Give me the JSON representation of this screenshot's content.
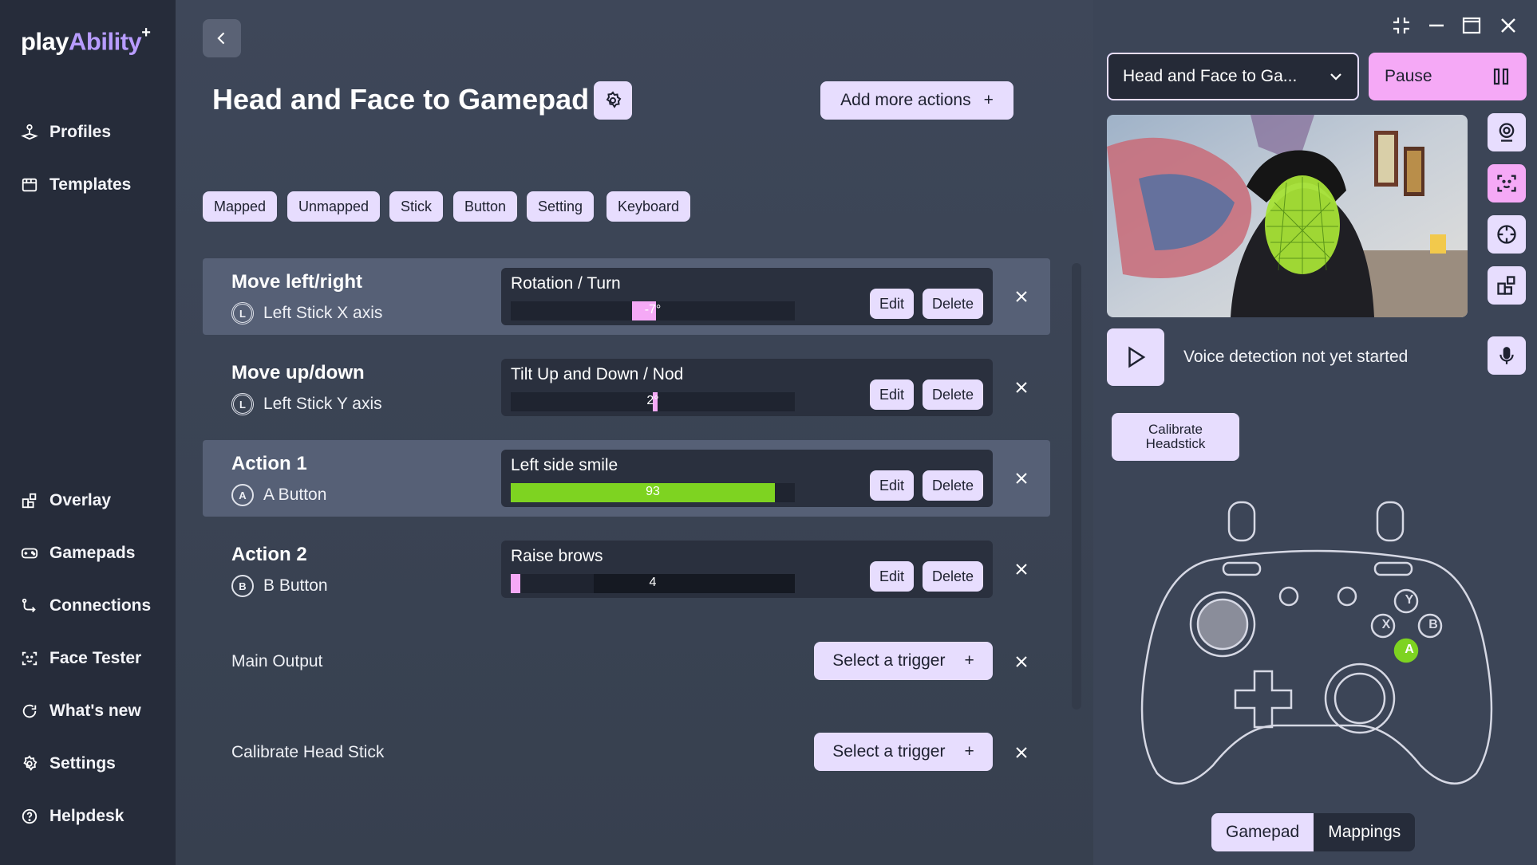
{
  "app": {
    "logo_main": "play",
    "logo_accent": "Ability",
    "logo_sup": "+"
  },
  "sidebar": {
    "top_items": [
      {
        "label": "Profiles",
        "icon": "joystick-icon"
      },
      {
        "label": "Templates",
        "icon": "templates-icon"
      }
    ],
    "bottom_items": [
      {
        "label": "Overlay",
        "icon": "overlay-icon"
      },
      {
        "label": "Gamepads",
        "icon": "gamepad-icon"
      },
      {
        "label": "Connections",
        "icon": "connections-icon"
      },
      {
        "label": "Face Tester",
        "icon": "face-scan-icon"
      },
      {
        "label": "What's new",
        "icon": "refresh-icon"
      },
      {
        "label": "Settings",
        "icon": "gear-icon"
      },
      {
        "label": "Helpdesk",
        "icon": "help-icon"
      }
    ]
  },
  "header": {
    "title": "Head and Face to Gamepad",
    "add_actions_label": "Add more actions",
    "add_icon": "+"
  },
  "filters": [
    "Mapped",
    "Unmapped",
    "Stick",
    "Button",
    "Setting",
    "Keyboard"
  ],
  "mappings": [
    {
      "title": "Move left/right",
      "input_badge": "L",
      "input_label": "Left Stick X axis",
      "trigger": "Rotation / Turn",
      "meter_value": "-7°",
      "meter_level_percent": 35,
      "meter_color": "#f5a9f6",
      "highlighted": true
    },
    {
      "title": "Move up/down",
      "input_badge": "L",
      "input_label": "Left Stick Y axis",
      "trigger": "Tilt Up and Down / Nod",
      "meter_value": "2°",
      "meter_level_percent": 40,
      "meter_color": "#f5a9f6",
      "highlighted": false
    },
    {
      "title": "Action 1",
      "input_badge": "A",
      "input_label": "A Button",
      "trigger": "Left side smile",
      "meter_value": "93",
      "meter_level_percent": 93,
      "meter_color": "#7ed321",
      "highlighted": true
    },
    {
      "title": "Action 2",
      "input_badge": "B",
      "input_label": "B Button",
      "trigger": "Raise brows",
      "meter_value": "4",
      "meter_level_percent": 4,
      "meter_color": "#f5a9f6",
      "highlighted": false
    }
  ],
  "row_buttons": {
    "edit": "Edit",
    "delete": "Delete",
    "remove": "×"
  },
  "extra_outputs": [
    {
      "label": "Main Output",
      "select_label": "Select a trigger"
    },
    {
      "label": "Calibrate Head Stick",
      "select_label": "Select a trigger"
    }
  ],
  "right_panel": {
    "profile_dropdown": "Head and Face to Ga...",
    "pause_label": "Pause",
    "voice_status": "Voice detection not yet started",
    "calibrate_label": "Calibrate Headstick",
    "view_tabs": [
      "Gamepad",
      "Mappings"
    ],
    "active_view_tab": "Gamepad",
    "gamepad_buttons": [
      "Y",
      "X",
      "B",
      "A"
    ],
    "active_gamepad_button": "A"
  },
  "colors": {
    "accent_lavender": "#e7ddfe",
    "accent_pink": "#f5a9f6",
    "accent_green": "#7ed321",
    "sidebar_bg": "#262c3a"
  }
}
